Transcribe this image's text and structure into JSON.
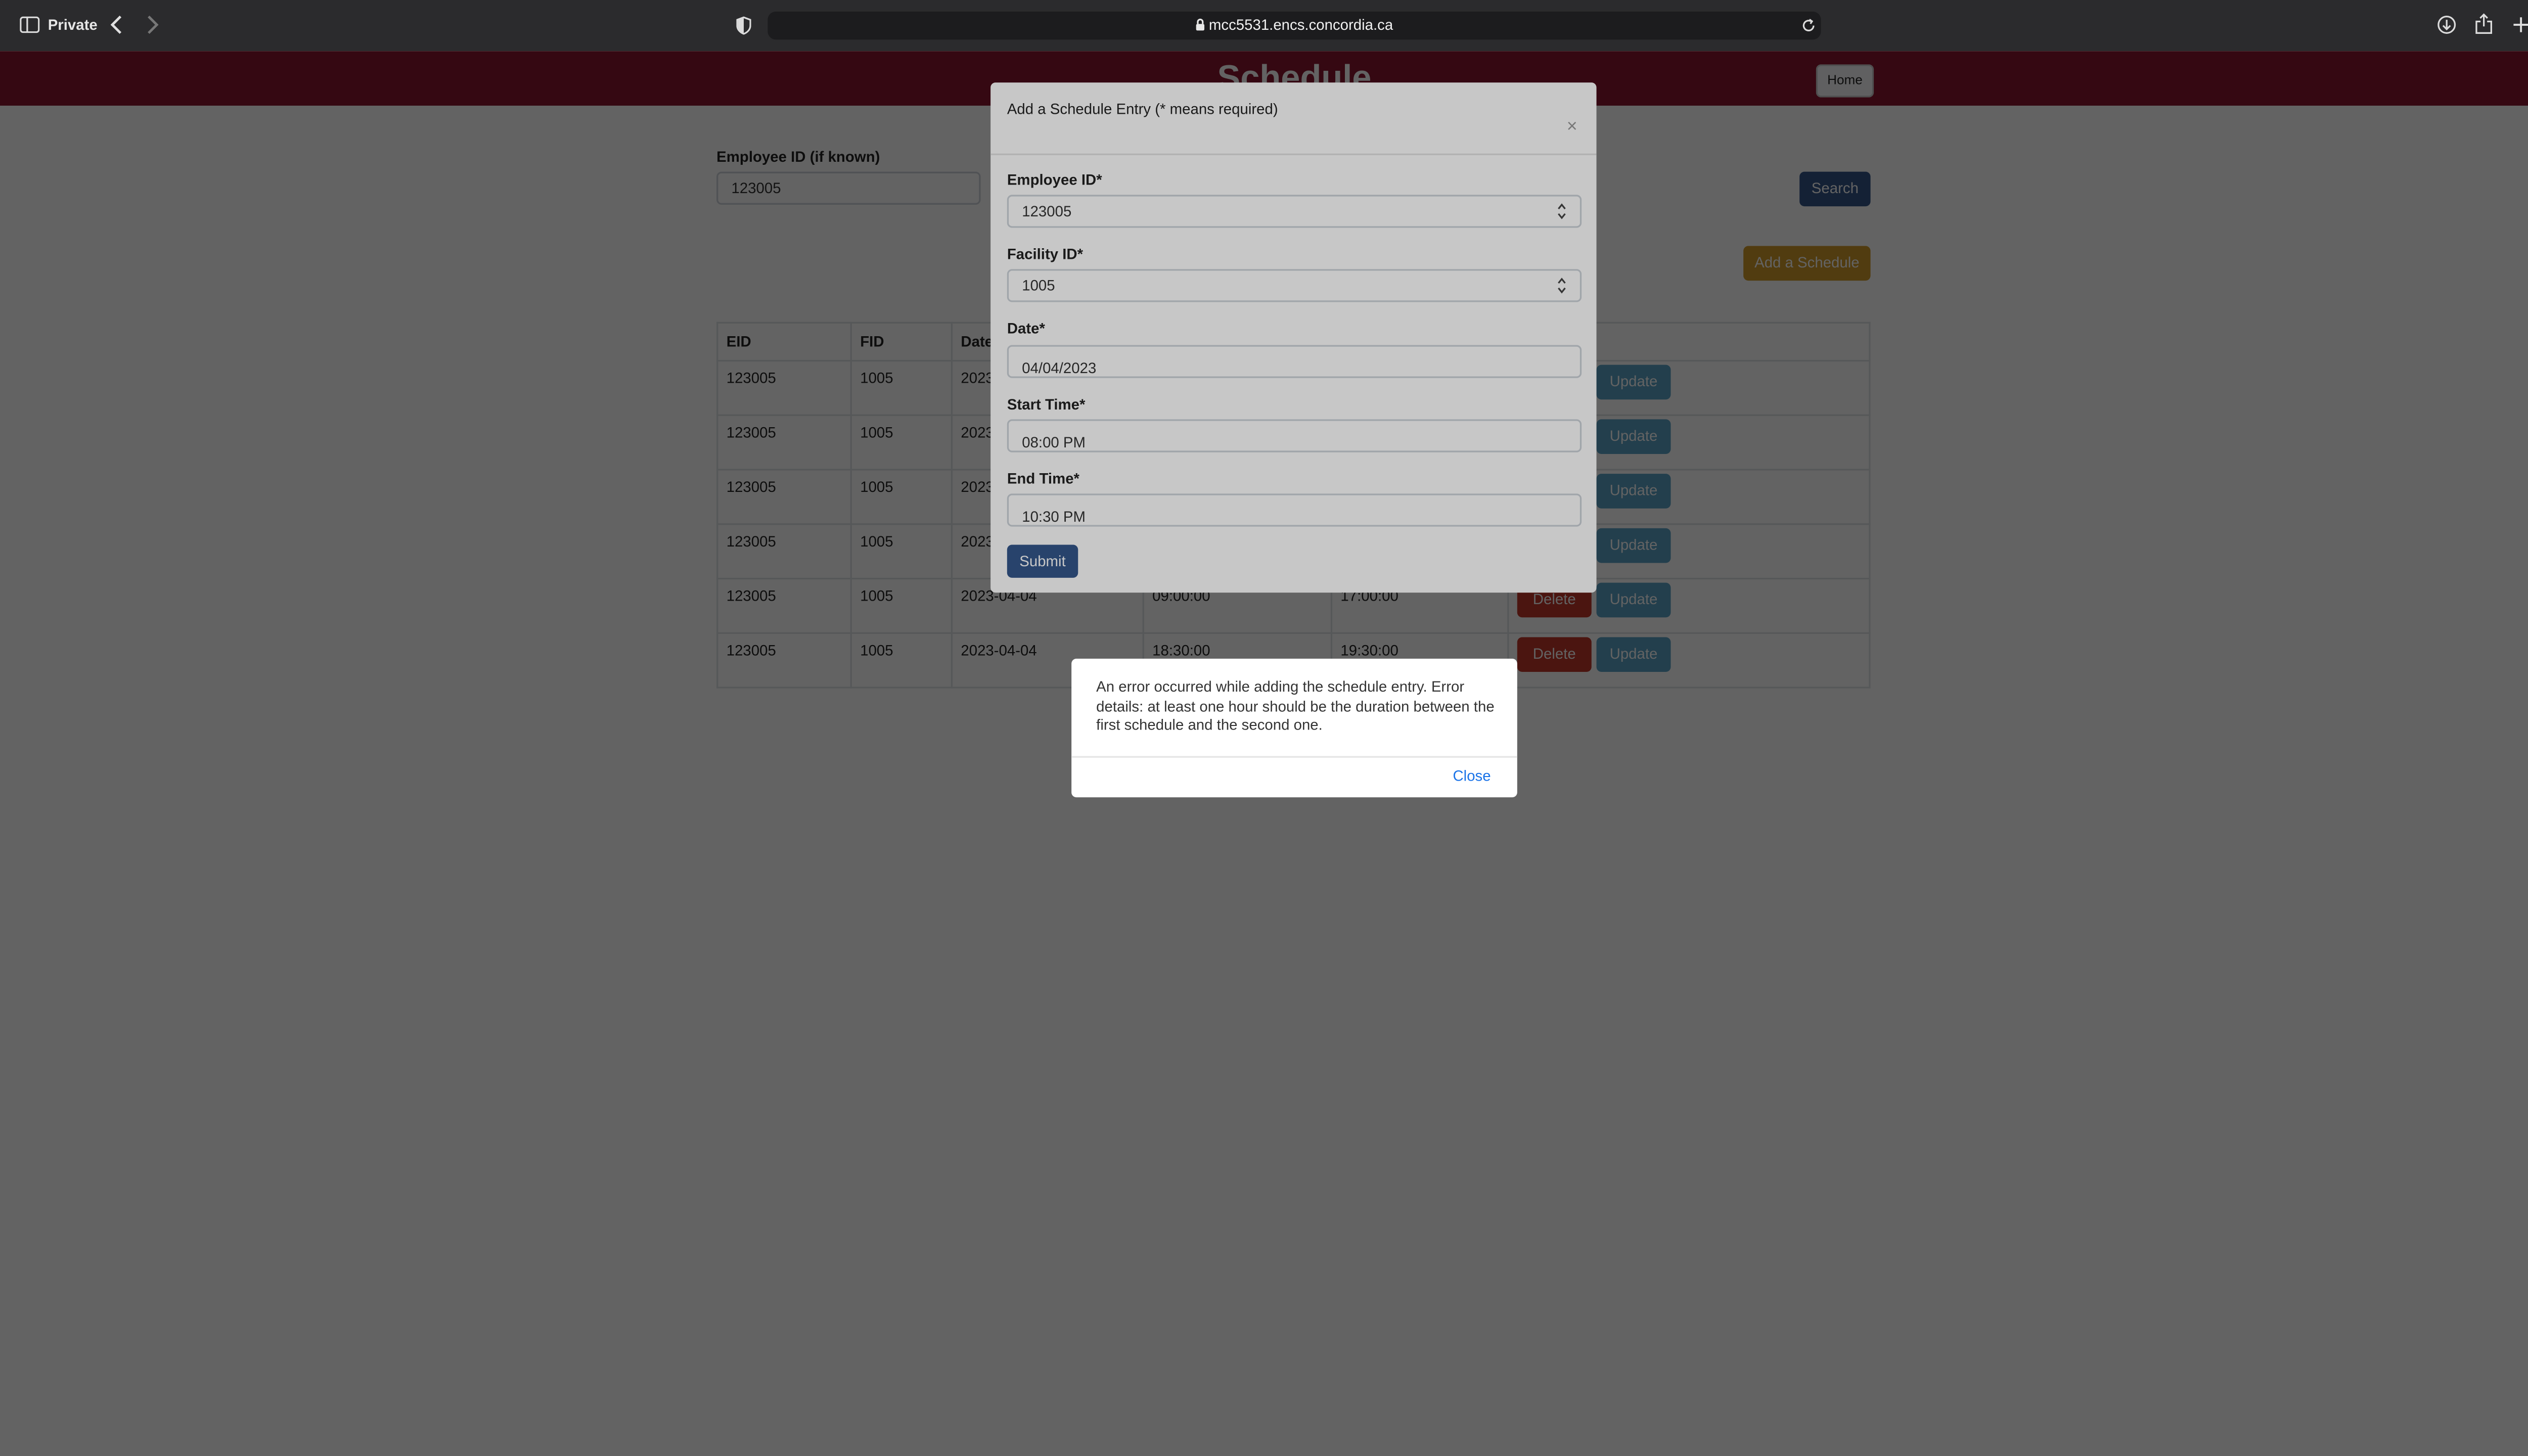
{
  "browser": {
    "mode_label": "Private",
    "url": "mcc5531.encs.concordia.ca"
  },
  "header": {
    "title": "Schedule",
    "home_label": "Home"
  },
  "search": {
    "label": "Employee ID (if known)",
    "value": "123005",
    "button_label": "Search"
  },
  "add_schedule_label": "Add a Schedule",
  "table": {
    "columns": [
      "EID",
      "FID",
      "Date",
      "",
      "",
      ""
    ],
    "rows": [
      {
        "eid": "123005",
        "fid": "1005",
        "date": "2023",
        "start": "",
        "end": ""
      },
      {
        "eid": "123005",
        "fid": "1005",
        "date": "2023",
        "start": "",
        "end": ""
      },
      {
        "eid": "123005",
        "fid": "1005",
        "date": "2023",
        "start": "",
        "end": ""
      },
      {
        "eid": "123005",
        "fid": "1005",
        "date": "2023",
        "start": "",
        "end": ""
      },
      {
        "eid": "123005",
        "fid": "1005",
        "date": "2023-04-04",
        "start": "09:00:00",
        "end": "17:00:00"
      },
      {
        "eid": "123005",
        "fid": "1005",
        "date": "2023-04-04",
        "start": "18:30:00",
        "end": "19:30:00"
      }
    ],
    "delete_label": "Delete",
    "update_label": "Update"
  },
  "modal": {
    "title": "Add a Schedule Entry (* means required)",
    "close_glyph": "×",
    "fields": {
      "employee_id": {
        "label": "Employee ID*",
        "value": "123005"
      },
      "facility_id": {
        "label": "Facility ID*",
        "value": "1005"
      },
      "date": {
        "label": "Date*",
        "value": "04/04/2023"
      },
      "start_time": {
        "label": "Start Time*",
        "value": "08:00 PM"
      },
      "end_time": {
        "label": "End Time*",
        "value": "10:30 PM"
      }
    },
    "submit_label": "Submit"
  },
  "alert": {
    "message": "An error occurred while adding the schedule entry. Error details: at least one hour should be the duration between the first schedule and the second one.",
    "close_label": "Close"
  },
  "colors": {
    "header_bg": "#8a1630",
    "primary": "#34568b",
    "warning": "#d09a2a",
    "danger": "#c0392b",
    "info": "#5aa3c7"
  },
  "icons": [
    "sidebar-icon",
    "back-icon",
    "forward-icon",
    "privacy-shield-icon",
    "lock-icon",
    "reload-icon",
    "download-icon",
    "share-icon",
    "new-tab-icon",
    "tabs-overview-icon"
  ]
}
